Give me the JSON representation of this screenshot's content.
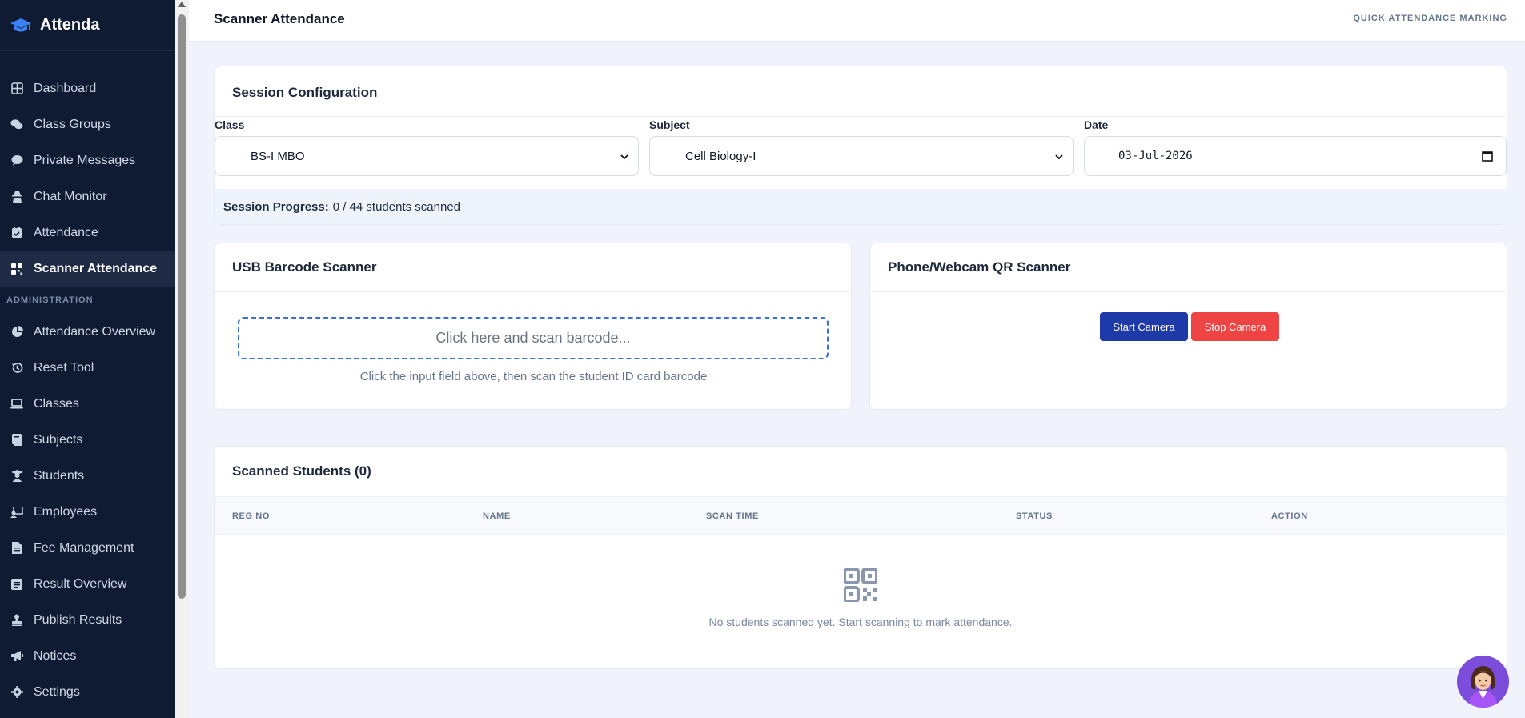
{
  "brand": {
    "name": "Attenda",
    "icon": "graduation-cap-icon"
  },
  "sidebar": {
    "items": [
      {
        "label": "Dashboard",
        "icon": "grid-icon"
      },
      {
        "label": "Class Groups",
        "icon": "chat-bubbles-icon"
      },
      {
        "label": "Private Messages",
        "icon": "message-icon"
      },
      {
        "label": "Chat Monitor",
        "icon": "user-secret-icon"
      },
      {
        "label": "Attendance",
        "icon": "calendar-check-icon"
      },
      {
        "label": "Scanner Attendance",
        "icon": "qrcode-icon",
        "active": true
      }
    ],
    "section_label": "ADMINISTRATION",
    "admin_items": [
      {
        "label": "Attendance Overview",
        "icon": "pie-chart-icon"
      },
      {
        "label": "Reset Tool",
        "icon": "history-icon"
      },
      {
        "label": "Classes",
        "icon": "laptop-icon"
      },
      {
        "label": "Subjects",
        "icon": "book-icon"
      },
      {
        "label": "Students",
        "icon": "graduate-icon"
      },
      {
        "label": "Employees",
        "icon": "chalkboard-teacher-icon"
      },
      {
        "label": "Fee Management",
        "icon": "invoice-icon"
      },
      {
        "label": "Result Overview",
        "icon": "report-icon"
      },
      {
        "label": "Publish Results",
        "icon": "stamp-icon"
      },
      {
        "label": "Notices",
        "icon": "megaphone-icon"
      },
      {
        "label": "Settings",
        "icon": "gear-icon"
      }
    ]
  },
  "header": {
    "title": "Scanner Attendance",
    "subtitle": "QUICK ATTENDANCE MARKING"
  },
  "session": {
    "title": "Session Configuration",
    "class_label": "Class",
    "class_value": "BS-I MBO",
    "subject_label": "Subject",
    "subject_value": "Cell Biology-I",
    "date_label": "Date",
    "date_value": "03-Jul-2026",
    "progress_label": "Session Progress:",
    "progress_text": "0 / 44 students scanned",
    "progress_scanned": 0,
    "progress_total": 44
  },
  "usb": {
    "title": "USB Barcode Scanner",
    "placeholder": "Click here and scan barcode...",
    "hint": "Click the input field above, then scan the student ID card barcode"
  },
  "qr": {
    "title": "Phone/Webcam QR Scanner",
    "start_label": "Start Camera",
    "stop_label": "Stop Camera"
  },
  "scanned": {
    "title": "Scanned Students (0)",
    "columns": [
      "REG NO",
      "NAME",
      "SCAN TIME",
      "STATUS",
      "ACTION"
    ],
    "empty_message": "No students scanned yet. Start scanning to mark attendance."
  },
  "colors": {
    "sidebar_bg": "#0f1a33",
    "accent": "#1e3aa8",
    "danger": "#ef4444",
    "brand_icon": "#3b82f6"
  }
}
